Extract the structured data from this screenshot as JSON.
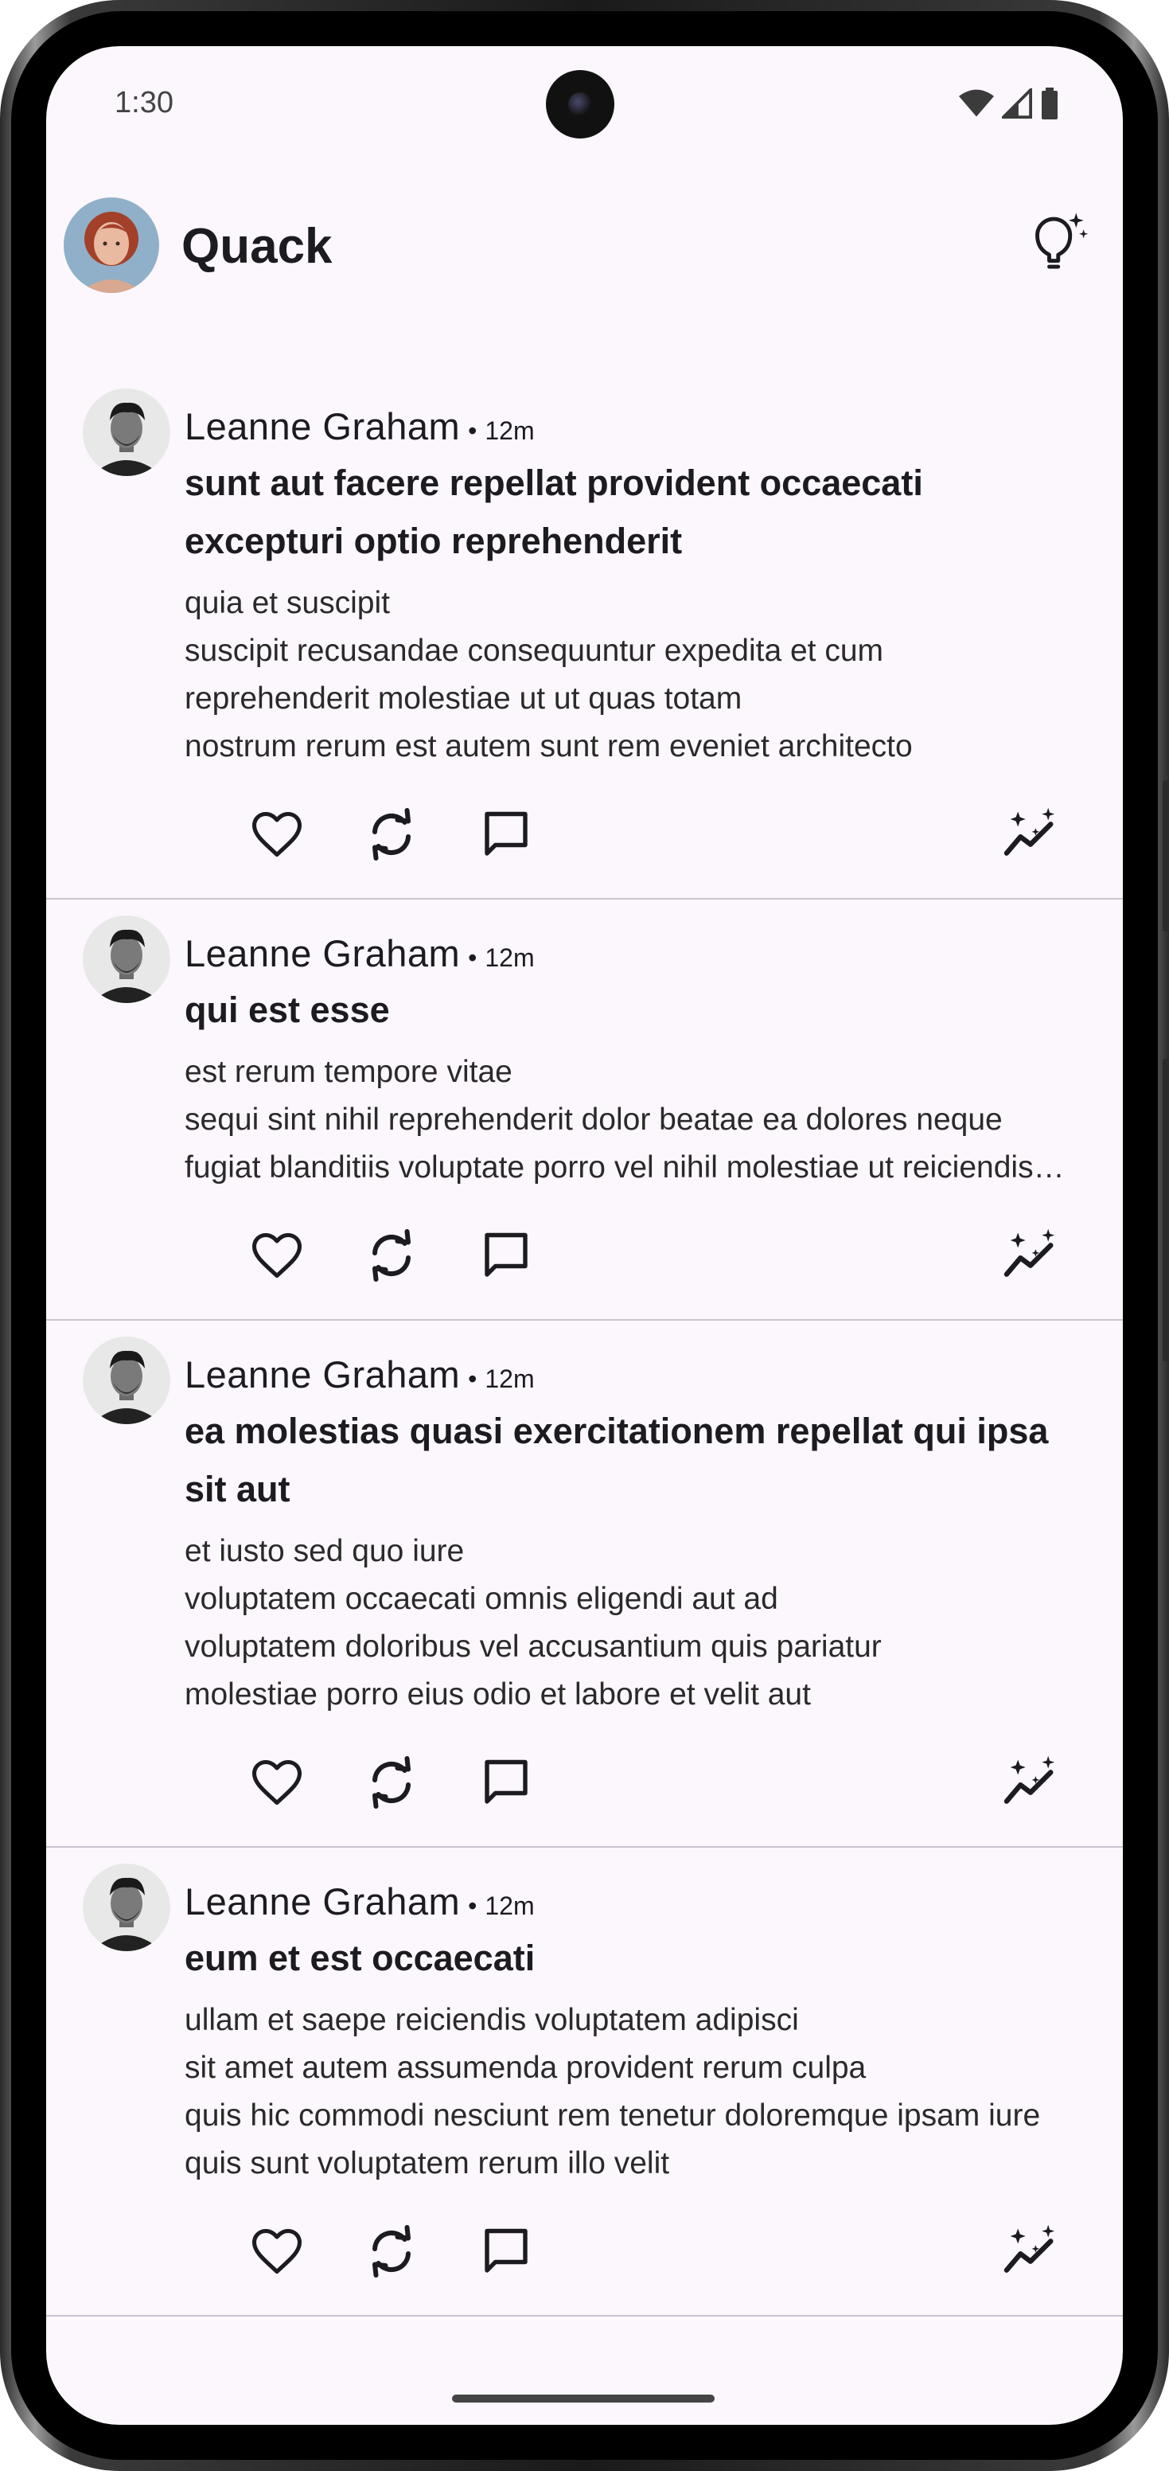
{
  "status_bar": {
    "time": "1:30",
    "icons": [
      "wifi-icon",
      "signal-icon",
      "battery-icon"
    ]
  },
  "app_bar": {
    "title": "Quack",
    "avatar": "user-avatar",
    "action_icon": "lightbulb-sparkle-icon"
  },
  "colors": {
    "background": "#fcf7fc",
    "text": "#1c1b1f",
    "divider": "#cac4d0"
  },
  "posts": [
    {
      "author": "Leanne Graham",
      "separator": "•",
      "time": "12m",
      "title": "sunt aut facere repellat provident occaecati excepturi optio reprehenderit",
      "body": "quia et suscipit\nsuscipit recusandae consequuntur expedita et cum\nreprehenderit molestiae ut ut quas totam\nnostrum rerum est autem sunt rem eveniet architecto"
    },
    {
      "author": "Leanne Graham",
      "separator": "•",
      "time": "12m",
      "title": "qui est esse",
      "body": "est rerum tempore vitae\nsequi sint nihil reprehenderit dolor beatae ea dolores neque\nfugiat blanditiis voluptate porro vel nihil molestiae ut reiciendis…"
    },
    {
      "author": "Leanne Graham",
      "separator": "•",
      "time": "12m",
      "title": "ea molestias quasi exercitationem repellat qui ipsa sit aut",
      "body": "et iusto sed quo iure\nvoluptatem occaecati omnis eligendi aut ad\nvoluptatem doloribus vel accusantium quis pariatur\nmolestiae porro eius odio et labore et velit aut"
    },
    {
      "author": "Leanne Graham",
      "separator": "•",
      "time": "12m",
      "title": "eum et est occaecati",
      "body": "ullam et saepe reiciendis voluptatem adipisci\nsit amet autem assumenda provident rerum culpa\nquis hic commodi nesciunt rem tenetur doloremque ipsam iure\nquis sunt voluptatem rerum illo velit"
    }
  ],
  "post_action_icons": [
    "heart-icon",
    "repost-icon",
    "comment-icon",
    "summarize-sparkle-icon"
  ]
}
